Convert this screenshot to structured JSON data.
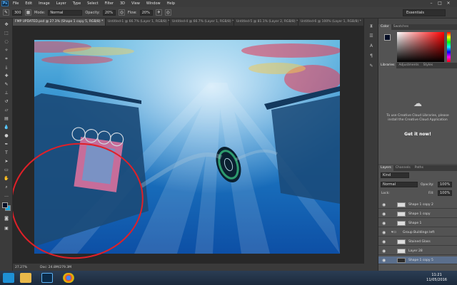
{
  "app": {
    "logo": "Ps"
  },
  "menubar": {
    "items": [
      "File",
      "Edit",
      "Image",
      "Layer",
      "Type",
      "Select",
      "Filter",
      "3D",
      "View",
      "Window",
      "Help"
    ]
  },
  "optionsbar": {
    "brush_size": "300",
    "mode_label": "Mode:",
    "mode_value": "Normal",
    "opacity_label": "Opacity:",
    "opacity_value": "20%",
    "flow_label": "Flow:",
    "flow_value": "20%",
    "workspace": "Essentials"
  },
  "tabs": [
    {
      "label": "FMP UPDATED.psd @ 27.3% (Shape 1 copy 5, RGB/8) *"
    },
    {
      "label": "Untitled-1 @ 66.7% (Layer 1, RGB/8) *"
    },
    {
      "label": "Untitled-4 @ 66.7% (Layer 1, RGB/8) *"
    },
    {
      "label": "Untitled-5 @ 81.1% (Layer 2, RGB/8) *"
    },
    {
      "label": "Untitled-6 @ 100% (Layer 1, RGB/8) *"
    }
  ],
  "statusbar": {
    "zoom": "27.27%",
    "doc": "Doc: 24.8M/279.3M"
  },
  "color_panel": {
    "tabs": [
      "Color",
      "Swatches"
    ],
    "fg_color": "#050e25",
    "bg_color": "#ffffff"
  },
  "libraries_panel": {
    "tabs": [
      "Libraries",
      "Adjustments",
      "Styles"
    ],
    "message": "To use Creative Cloud Libraries, please install the Creative Cloud Application",
    "button": "Get it now!"
  },
  "layers_panel": {
    "tabs": [
      "Layers",
      "Channels",
      "Paths"
    ],
    "filter_kind": "Kind",
    "blend_mode": "Normal",
    "opacity_label": "Opacity:",
    "opacity_value": "100%",
    "lock_label": "Lock:",
    "fill_label": "Fill:",
    "fill_value": "100%",
    "layers": [
      {
        "name": "Shape 1 copy 2",
        "group": false,
        "selected": false
      },
      {
        "name": "Shape 1 copy",
        "group": false,
        "selected": false
      },
      {
        "name": "Shape 1",
        "group": false,
        "selected": false
      },
      {
        "name": "Group Buildings left",
        "group": true,
        "selected": false
      },
      {
        "name": "Stained Glass",
        "group": false,
        "selected": false
      },
      {
        "name": "Layer 28",
        "group": false,
        "selected": false
      },
      {
        "name": "Shape 1 copy 5",
        "group": false,
        "selected": true
      }
    ]
  },
  "taskbar": {
    "time": "11:21",
    "date": "11/05/2016"
  }
}
